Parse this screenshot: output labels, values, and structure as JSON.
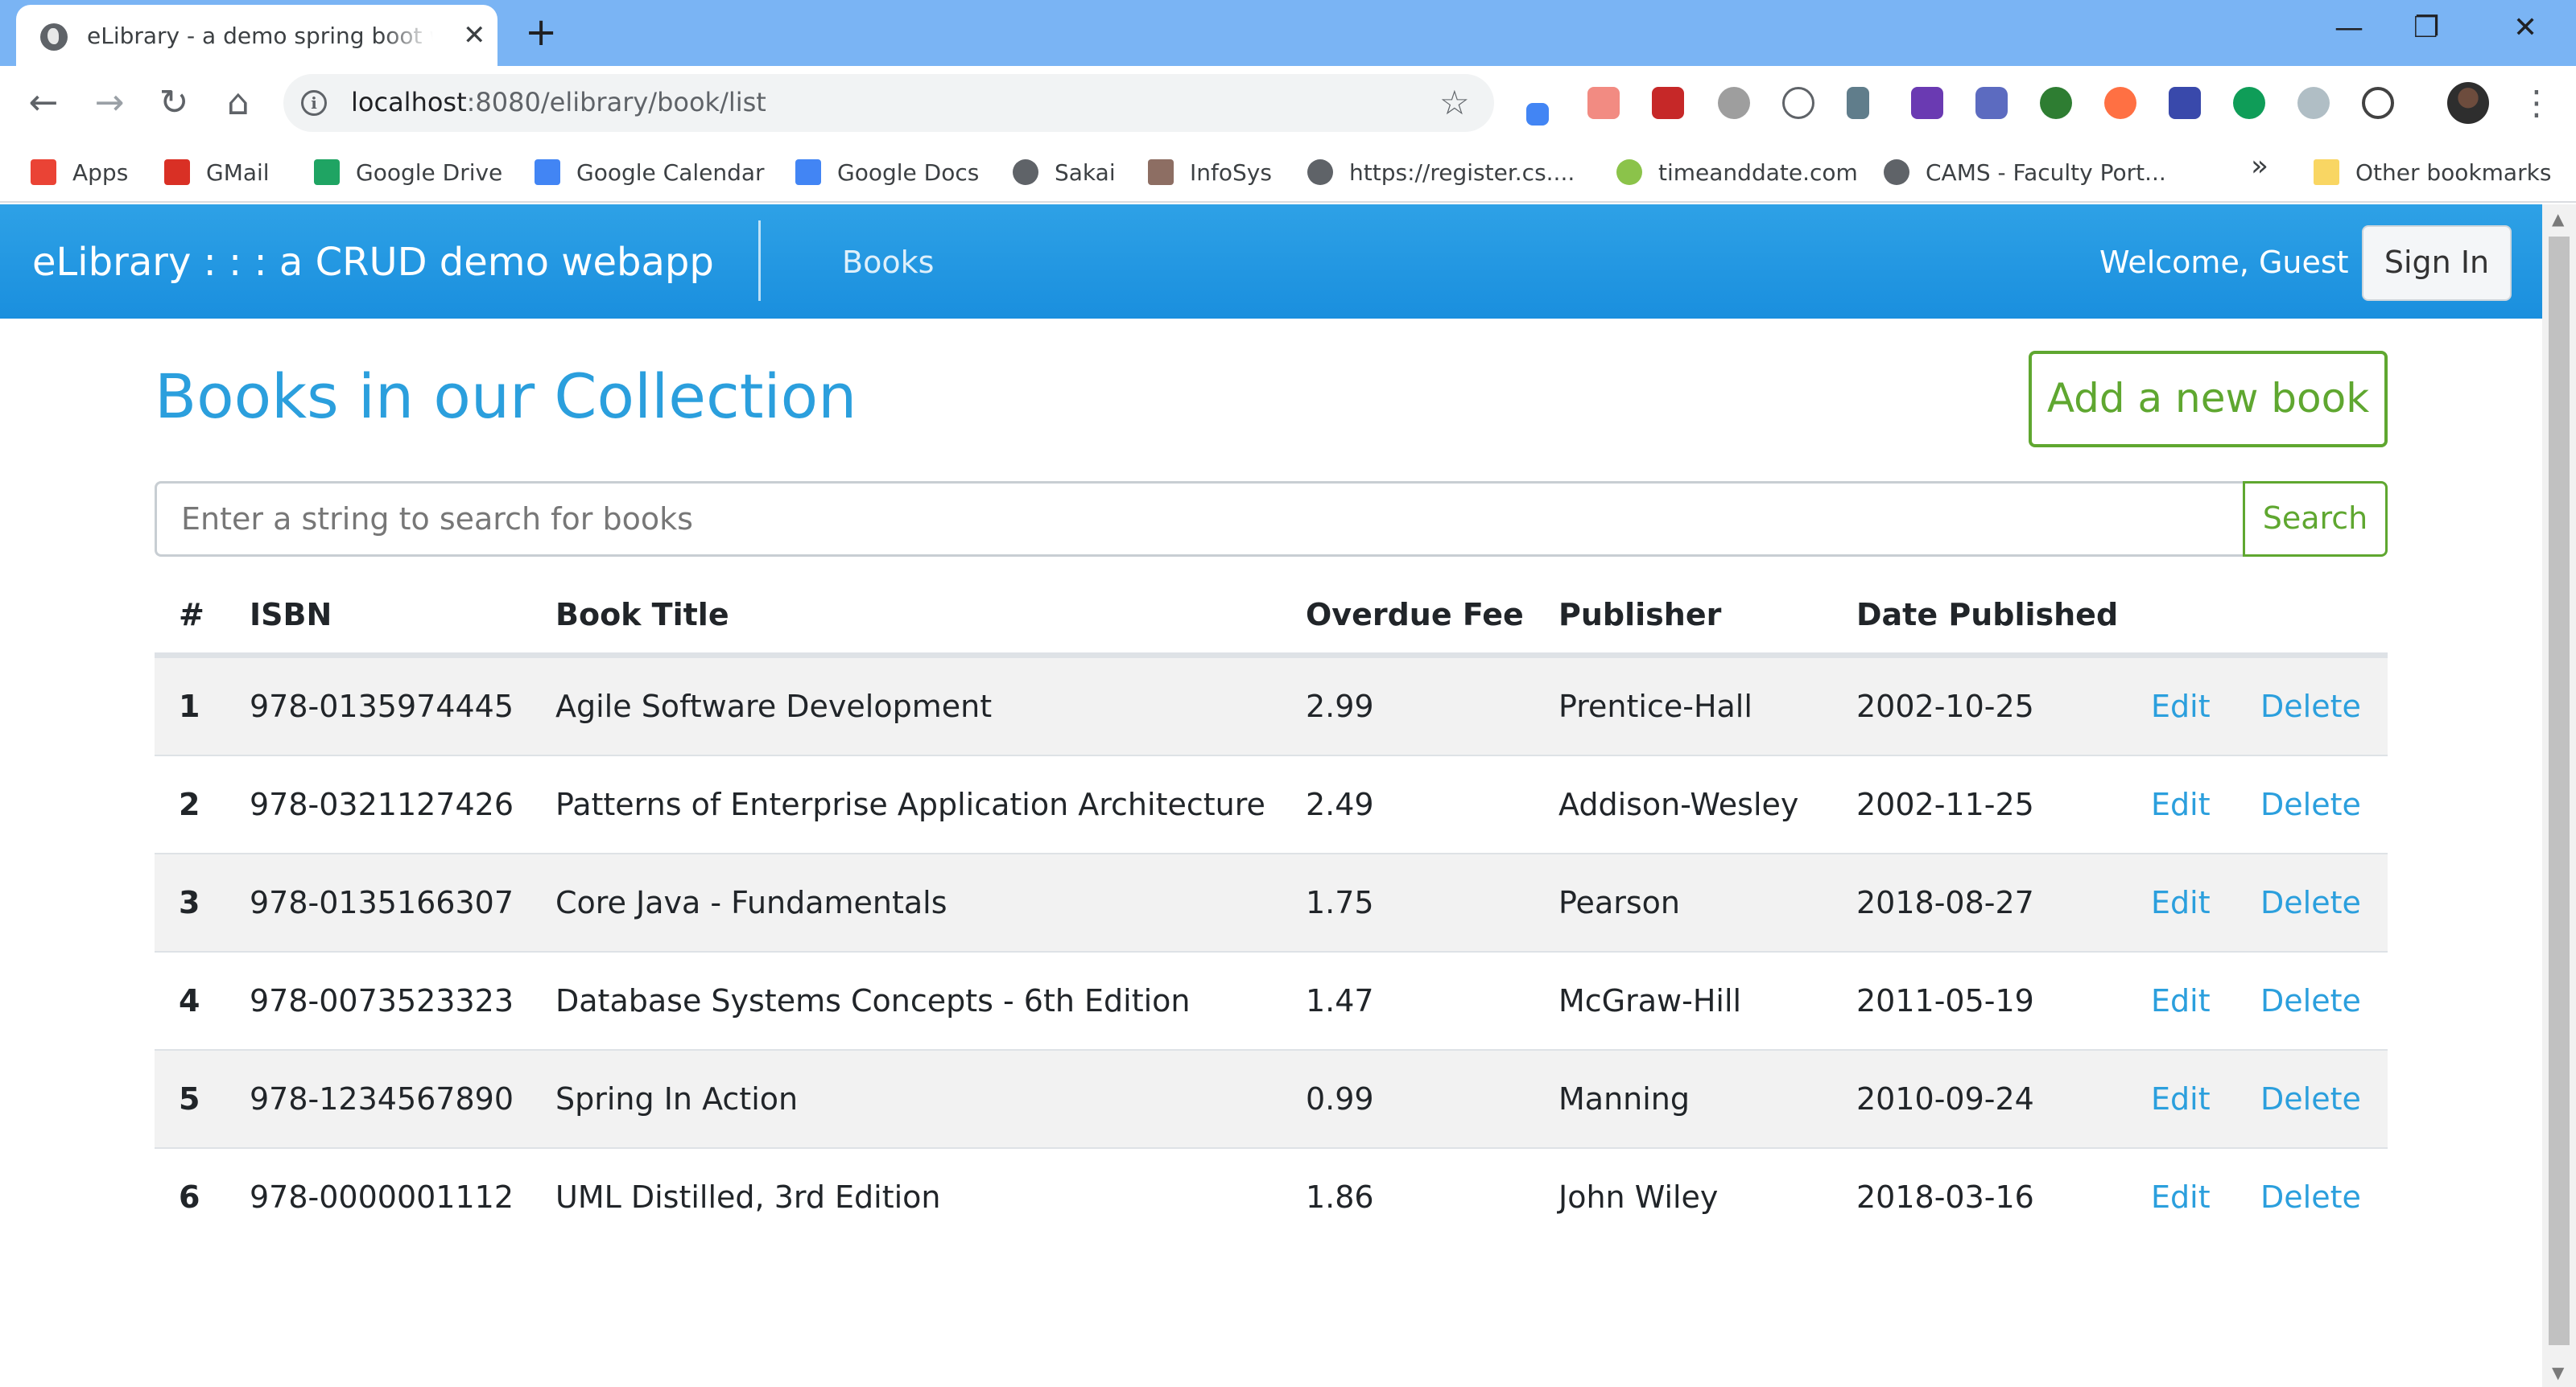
{
  "browser": {
    "tab_title": "eLibrary - a demo spring boot webapp",
    "close_glyph": "✕",
    "new_tab_glyph": "+",
    "url_host": "localhost",
    "url_path": ":8080/elibrary/book/list",
    "window": {
      "minimize": "—",
      "restore": "❐",
      "close": "✕"
    },
    "nav": {
      "back": "←",
      "forward": "→",
      "reload": "↻",
      "home": "⌂"
    },
    "star_glyph": "☆",
    "menu_glyph": "⋮",
    "bookmarks": [
      {
        "label": "Apps",
        "icon": "apps-grid-icon",
        "color": "#ea4335"
      },
      {
        "label": "GMail",
        "icon": "gmail-icon",
        "color": "#d93025"
      },
      {
        "label": "Google Drive",
        "icon": "google-drive-icon",
        "color": "#1fa463"
      },
      {
        "label": "Google Calendar",
        "icon": "google-calendar-icon",
        "color": "#4285f4"
      },
      {
        "label": "Google Docs",
        "icon": "google-docs-icon",
        "color": "#4285f4"
      },
      {
        "label": "Sakai",
        "icon": "globe-icon",
        "color": "#5f6368"
      },
      {
        "label": "InfoSys",
        "icon": "infosys-icon",
        "color": "#8d6e63"
      },
      {
        "label": "https://register.cs....",
        "icon": "globe-icon",
        "color": "#5f6368"
      },
      {
        "label": "timeanddate.com",
        "icon": "timeanddate-icon",
        "color": "#8bc34a"
      },
      {
        "label": "CAMS - Faculty Port...",
        "icon": "globe-icon",
        "color": "#5f6368"
      }
    ],
    "bookmarks_more": "»",
    "other_bookmarks": "Other bookmarks"
  },
  "app": {
    "brand": "eLibrary : : : a CRUD demo webapp",
    "nav_books": "Books",
    "welcome": "Welcome, Guest",
    "signin": "Sign In",
    "page_title": "Books in our Collection",
    "add_button": "Add a new book",
    "search_placeholder": "Enter a string to search for books",
    "search_button": "Search",
    "columns": [
      "#",
      "ISBN",
      "Book Title",
      "Overdue Fee",
      "Publisher",
      "Date Published"
    ],
    "rows": [
      {
        "num": "1",
        "isbn": "978-0135974445",
        "title": "Agile Software Development",
        "fee": "2.99",
        "publisher": "Prentice-Hall",
        "date": "2002-10-25",
        "edit": "Edit",
        "delete": "Delete"
      },
      {
        "num": "2",
        "isbn": "978-0321127426",
        "title": "Patterns of Enterprise Application Architecture",
        "fee": "2.49",
        "publisher": "Addison-Wesley",
        "date": "2002-11-25",
        "edit": "Edit",
        "delete": "Delete"
      },
      {
        "num": "3",
        "isbn": "978-0135166307",
        "title": "Core Java - Fundamentals",
        "fee": "1.75",
        "publisher": "Pearson",
        "date": "2018-08-27",
        "edit": "Edit",
        "delete": "Delete"
      },
      {
        "num": "4",
        "isbn": "978-0073523323",
        "title": "Database Systems Concepts - 6th Edition",
        "fee": "1.47",
        "publisher": "McGraw-Hill",
        "date": "2011-05-19",
        "edit": "Edit",
        "delete": "Delete"
      },
      {
        "num": "5",
        "isbn": "978-1234567890",
        "title": "Spring In Action",
        "fee": "0.99",
        "publisher": "Manning",
        "date": "2010-09-24",
        "edit": "Edit",
        "delete": "Delete"
      },
      {
        "num": "6",
        "isbn": "978-0000001112",
        "title": "UML Distilled, 3rd Edition",
        "fee": "1.86",
        "publisher": "John Wiley",
        "date": "2018-03-16",
        "edit": "Edit",
        "delete": "Delete"
      }
    ]
  },
  "colors": {
    "navbar": "#1a8fde",
    "title_blue": "#2b9fdd",
    "success_green": "#5fa730",
    "stripe": "#f2f2f2",
    "tab_strip": "#7ab4f4"
  }
}
